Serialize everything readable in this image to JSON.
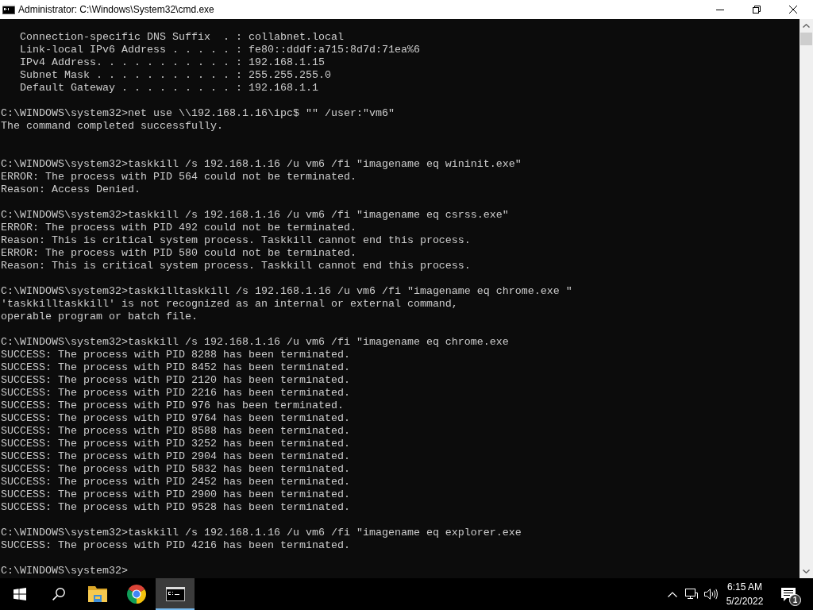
{
  "window": {
    "title": "Administrator: C:\\Windows\\System32\\cmd.exe"
  },
  "console": {
    "lines": [
      {
        "kind": "indented",
        "text": "Connection-specific DNS Suffix  . : collabnet.local"
      },
      {
        "kind": "indented",
        "text": "Link-local IPv6 Address . . . . . : fe80::dddf:a715:8d7d:71ea%6"
      },
      {
        "kind": "indented",
        "text": "IPv4 Address. . . . . . . . . . . : 192.168.1.15"
      },
      {
        "kind": "indented",
        "text": "Subnet Mask . . . . . . . . . . . : 255.255.255.0"
      },
      {
        "kind": "indented",
        "text": "Default Gateway . . . . . . . . . : 192.168.1.1"
      },
      {
        "kind": "blank"
      },
      {
        "kind": "text",
        "text": "C:\\WINDOWS\\system32>net use \\\\192.168.1.16\\ipc$ \"\" /user:\"vm6\""
      },
      {
        "kind": "text",
        "text": "The command completed successfully."
      },
      {
        "kind": "blank"
      },
      {
        "kind": "blank"
      },
      {
        "kind": "text",
        "text": "C:\\WINDOWS\\system32>taskkill /s 192.168.1.16 /u vm6 /fi \"imagename eq wininit.exe\""
      },
      {
        "kind": "text",
        "text": "ERROR: The process with PID 564 could not be terminated."
      },
      {
        "kind": "text",
        "text": "Reason: Access Denied."
      },
      {
        "kind": "blank"
      },
      {
        "kind": "text",
        "text": "C:\\WINDOWS\\system32>taskkill /s 192.168.1.16 /u vm6 /fi \"imagename eq csrss.exe\""
      },
      {
        "kind": "text",
        "text": "ERROR: The process with PID 492 could not be terminated."
      },
      {
        "kind": "text",
        "text": "Reason: This is critical system process. Taskkill cannot end this process."
      },
      {
        "kind": "text",
        "text": "ERROR: The process with PID 580 could not be terminated."
      },
      {
        "kind": "text",
        "text": "Reason: This is critical system process. Taskkill cannot end this process."
      },
      {
        "kind": "blank"
      },
      {
        "kind": "text",
        "text": "C:\\WINDOWS\\system32>taskkilltaskkill /s 192.168.1.16 /u vm6 /fi \"imagename eq chrome.exe \""
      },
      {
        "kind": "text",
        "text": "'taskkilltaskkill' is not recognized as an internal or external command,"
      },
      {
        "kind": "text",
        "text": "operable program or batch file."
      },
      {
        "kind": "blank"
      },
      {
        "kind": "text",
        "text": "C:\\WINDOWS\\system32>taskkill /s 192.168.1.16 /u vm6 /fi \"imagename eq chrome.exe"
      },
      {
        "kind": "text",
        "text": "SUCCESS: The process with PID 8288 has been terminated."
      },
      {
        "kind": "text",
        "text": "SUCCESS: The process with PID 8452 has been terminated."
      },
      {
        "kind": "text",
        "text": "SUCCESS: The process with PID 2120 has been terminated."
      },
      {
        "kind": "text",
        "text": "SUCCESS: The process with PID 2216 has been terminated."
      },
      {
        "kind": "text",
        "text": "SUCCESS: The process with PID 976 has been terminated."
      },
      {
        "kind": "text",
        "text": "SUCCESS: The process with PID 9764 has been terminated."
      },
      {
        "kind": "text",
        "text": "SUCCESS: The process with PID 8588 has been terminated."
      },
      {
        "kind": "text",
        "text": "SUCCESS: The process with PID 3252 has been terminated."
      },
      {
        "kind": "text",
        "text": "SUCCESS: The process with PID 2904 has been terminated."
      },
      {
        "kind": "text",
        "text": "SUCCESS: The process with PID 5832 has been terminated."
      },
      {
        "kind": "text",
        "text": "SUCCESS: The process with PID 2452 has been terminated."
      },
      {
        "kind": "text",
        "text": "SUCCESS: The process with PID 2900 has been terminated."
      },
      {
        "kind": "text",
        "text": "SUCCESS: The process with PID 9528 has been terminated."
      },
      {
        "kind": "blank"
      },
      {
        "kind": "text",
        "text": "C:\\WINDOWS\\system32>taskkill /s 192.168.1.16 /u vm6 /fi \"imagename eq explorer.exe"
      },
      {
        "kind": "text",
        "text": "SUCCESS: The process with PID 4216 has been terminated."
      },
      {
        "kind": "blank"
      },
      {
        "kind": "text",
        "text": "C:\\WINDOWS\\system32>"
      }
    ]
  },
  "taskbar": {
    "buttons": [
      {
        "kind": "start",
        "selected": false
      },
      {
        "kind": "search",
        "selected": false
      },
      {
        "kind": "folder",
        "selected": false
      },
      {
        "kind": "browser",
        "selected": false
      },
      {
        "kind": "terminal",
        "selected": true
      }
    ],
    "tray": {
      "time": "6:15 AM",
      "date": "5/2/2022",
      "notification_count": "1"
    }
  }
}
